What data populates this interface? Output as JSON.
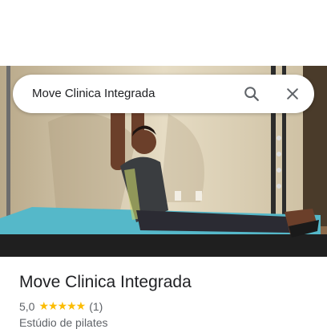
{
  "search": {
    "query": "Move Clinica Integrada"
  },
  "place": {
    "name": "Move Clinica Integrada",
    "rating": "5,0",
    "stars": "★★★★★",
    "review_count": "(1)",
    "category": "Estúdio de pilates"
  },
  "colors": {
    "star": "#fbbc04",
    "text_primary": "#202124",
    "text_secondary": "#5f6368"
  },
  "icons": [
    "search-icon",
    "close-icon"
  ]
}
